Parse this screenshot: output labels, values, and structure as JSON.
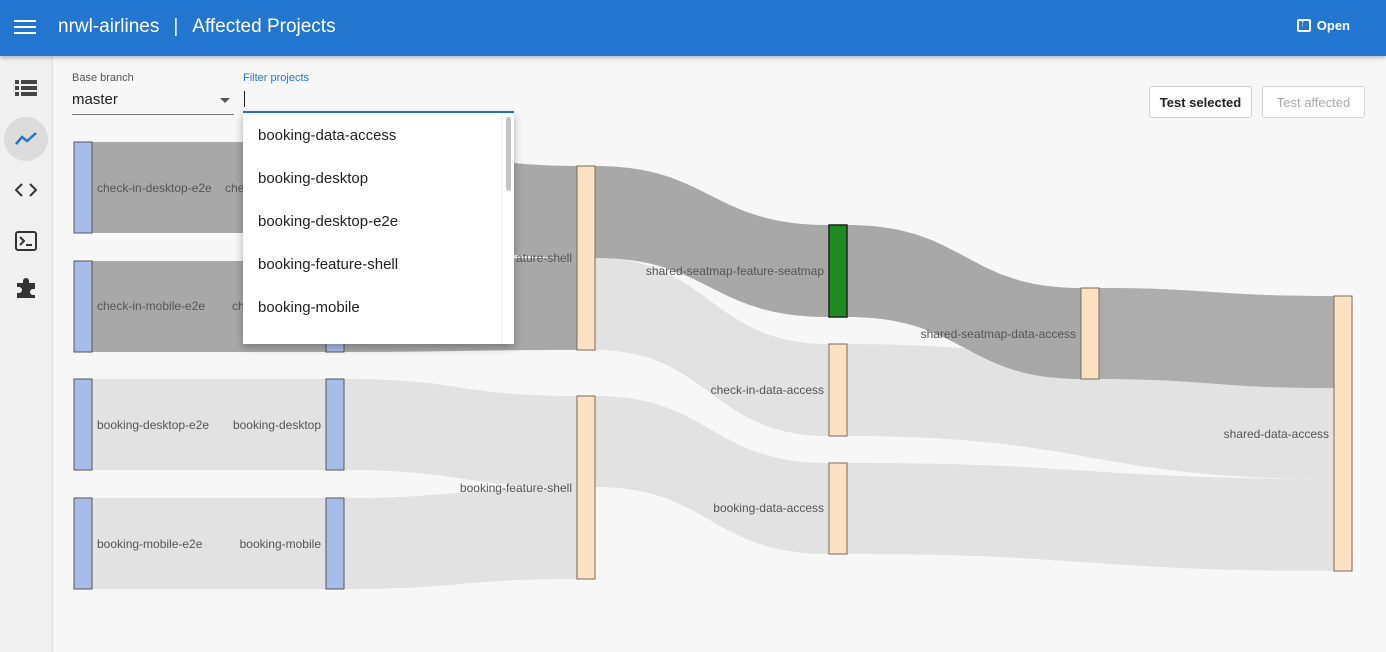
{
  "header": {
    "app_name": "nrwl-airlines",
    "separator": "|",
    "page_title": "Affected Projects",
    "open_label": "Open"
  },
  "sidebar": {
    "items": [
      {
        "icon": "list-icon"
      },
      {
        "icon": "trending-icon",
        "active": true
      },
      {
        "icon": "code-icon"
      },
      {
        "icon": "terminal-icon"
      },
      {
        "icon": "puzzle-icon"
      }
    ]
  },
  "controls": {
    "base_branch_label": "Base branch",
    "base_branch_value": "master",
    "filter_label": "Filter projects",
    "filter_value": "",
    "test_selected_label": "Test selected",
    "test_affected_label": "Test affected"
  },
  "filter_dropdown": {
    "options": [
      "booking-data-access",
      "booking-desktop",
      "booking-desktop-e2e",
      "booking-feature-shell",
      "booking-mobile"
    ]
  },
  "graph": {
    "colors": {
      "e2e_node": "#a7bce8",
      "lib_node": "#fde1c3",
      "selected_node": "#1f8a1f",
      "link_selected": "#a8a8a8",
      "link_default": "#e2e2e2"
    },
    "labels": {
      "check_in_desktop_e2e": "check-in-desktop-e2e",
      "check_in_desktop_partial": "che",
      "check_in_mobile_e2e": "check-in-mobile-e2e",
      "check_in_mobile_partial": "ch",
      "booking_desktop_e2e": "booking-desktop-e2e",
      "booking_desktop": "booking-desktop",
      "booking_mobile_e2e": "booking-mobile-e2e",
      "booking_mobile": "booking-mobile",
      "check_in_feature_shell_partial": "ature-shell",
      "booking_feature_shell": "booking-feature-shell",
      "shared_seatmap_feature_seatmap": "shared-seatmap-feature-seatmap",
      "check_in_data_access": "check-in-data-access",
      "booking_data_access": "booking-data-access",
      "shared_seatmap_data_access": "shared-seatmap-data-access",
      "shared_data_access": "shared-data-access"
    }
  }
}
